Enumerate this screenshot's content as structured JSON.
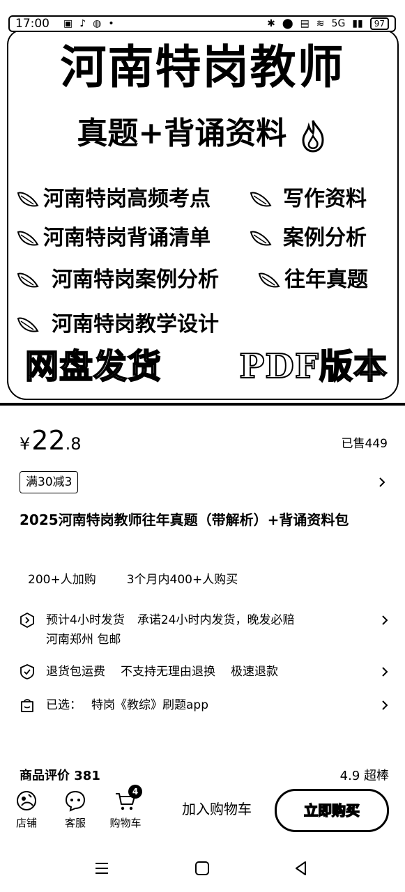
{
  "status_bar": {
    "time": "17:00",
    "network": "5G",
    "battery": "97"
  },
  "banner": {
    "title": "河南特岗教师",
    "subtitle": "真题+背诵资料",
    "features_left": [
      "河南特岗高频考点",
      "河南特岗背诵清单",
      "河南特岗案例分析",
      "河南特岗教学设计"
    ],
    "features_right": [
      "写作资料",
      "案例分析",
      "往年真题"
    ],
    "footer_left": "网盘发货",
    "footer_right": "PDF版本"
  },
  "price": {
    "symbol": "¥",
    "integer": "22",
    "decimal": ".8",
    "sold": "已售449"
  },
  "coupon": {
    "label": "满30减3"
  },
  "product": {
    "title": "2025河南特岗教师往年真题（带解析）+背诵资料包"
  },
  "stats": {
    "cart_adds": "200+人加购",
    "purchases": "3个月内400+人购买"
  },
  "shipping": {
    "estimate": "预计4小时发货",
    "promise": "承诺24小时内发货，晚发必赔",
    "origin": "河南郑州",
    "free_shipping": "包邮"
  },
  "guarantee": {
    "items": [
      "退货包运费",
      "不支持无理由退换",
      "极速退款"
    ]
  },
  "selection": {
    "label": "已选：",
    "value": "特岗《教综》刷题app"
  },
  "reviews": {
    "title": "商品评价 381",
    "rating": "4.9 超棒"
  },
  "action_bar": {
    "store": "店铺",
    "service": "客服",
    "cart": "购物车",
    "cart_count": "4",
    "add_to_cart": "加入购物车",
    "buy_now": "立即购买"
  },
  "colors": {
    "text": "#000000",
    "background": "#ffffff"
  }
}
